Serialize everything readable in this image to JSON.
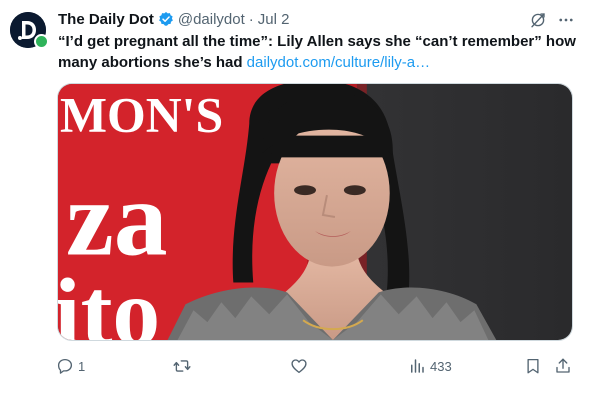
{
  "tweet": {
    "author": {
      "display_name": "The Daily Dot",
      "handle": "@dailydot",
      "separator": "·",
      "date": "Jul 2",
      "verified": true,
      "avatar_icon": "daily-dot-logo-icon"
    },
    "text": {
      "bold_part": "“I’d get pregnant all the time”: Lily Allen says she “can’t remember” how many abortions she’s had",
      "link": "dailydot.com/culture/lily-a…"
    },
    "media": {
      "backdrop_letters": [
        "MON'S",
        "za",
        "ito"
      ]
    },
    "actions": {
      "reply_count": "1",
      "retweet_count": "",
      "like_count": "",
      "views_count": "433"
    },
    "colors": {
      "accent": "#1d9bf0",
      "secondary_text": "#536471",
      "primary_text": "#0f1419",
      "online": "#2fb35a"
    }
  }
}
